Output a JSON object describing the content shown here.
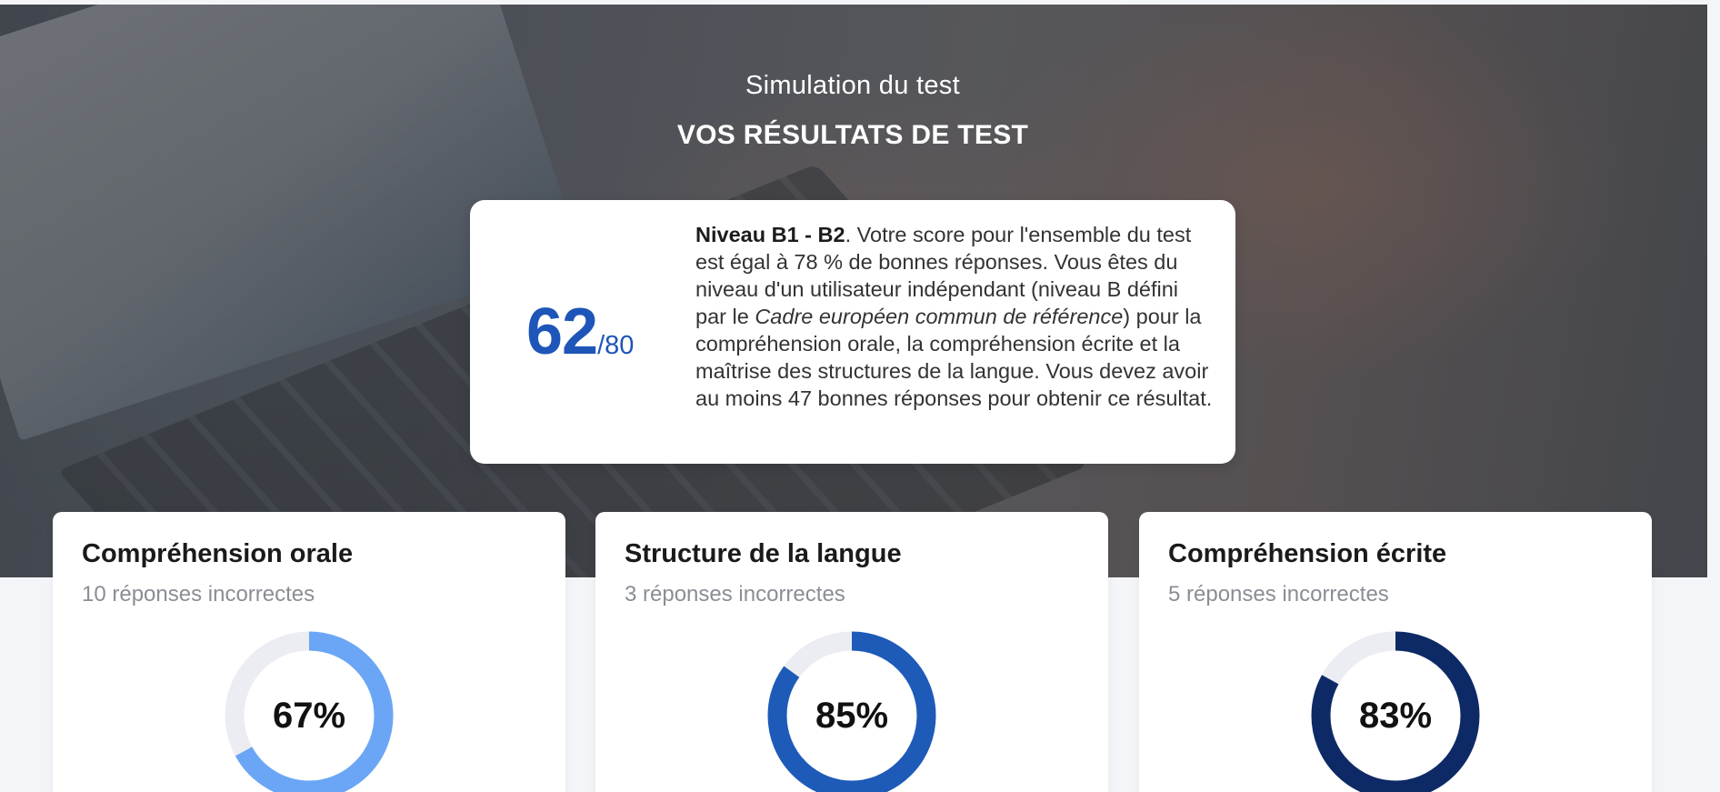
{
  "header": {
    "subtitle": "Simulation du test",
    "title": "VOS RÉSULTATS DE TEST"
  },
  "score": {
    "value": "62",
    "max": "/80",
    "level": "Niveau B1 - B2",
    "text_part1": ". Votre score pour l'ensemble du test est égal à 78 % de bonnes réponses. Vous êtes du niveau d'un utilisateur indépendant (niveau B défini par le ",
    "text_italic": "Cadre européen commun de référence",
    "text_part2": ") pour la compréhension orale, la compréhension écrite et la maîtrise des structures de la langue. Vous devez avoir au moins 47 bonnes réponses pour obtenir ce résultat."
  },
  "sections": [
    {
      "title": "Compréhension orale",
      "subtitle": "10 réponses incorrectes",
      "percent_label": "67%",
      "percent": 67,
      "color": "#6aa6f5"
    },
    {
      "title": "Structure de la langue",
      "subtitle": "3 réponses incorrectes",
      "percent_label": "85%",
      "percent": 85,
      "color": "#1e5ab8"
    },
    {
      "title": "Compréhension écrite",
      "subtitle": "5 réponses incorrectes",
      "percent_label": "83%",
      "percent": 83,
      "color": "#0e2a66"
    }
  ],
  "colors": {
    "track": "#ebedf2",
    "score_blue": "#1e55b8"
  }
}
